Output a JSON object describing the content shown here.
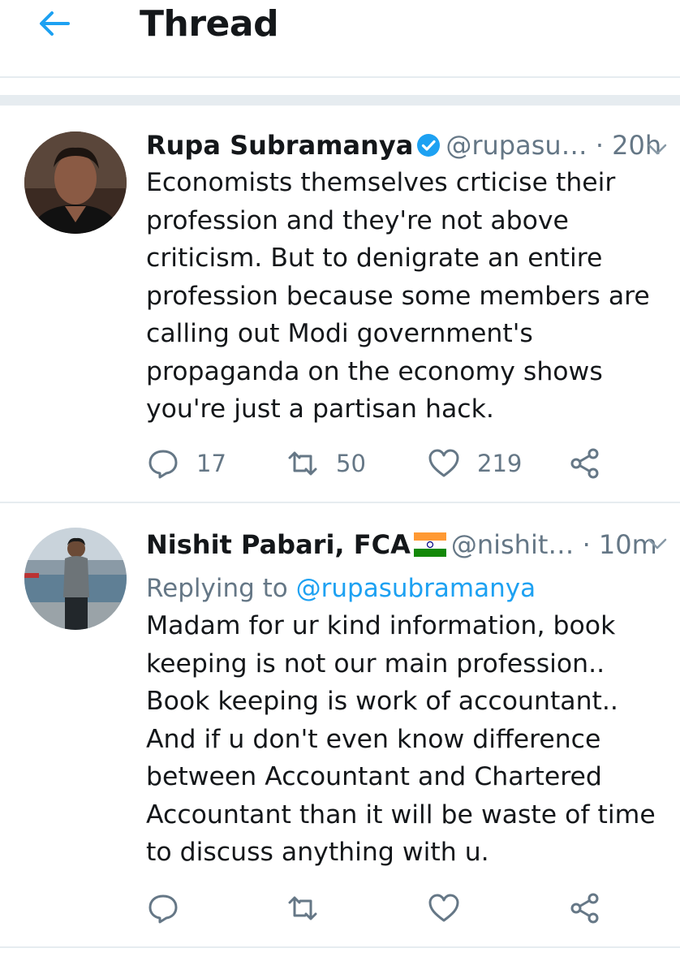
{
  "header": {
    "title": "Thread",
    "back_icon": "arrow-left-icon"
  },
  "tweets": [
    {
      "name": "Rupa Subramanya",
      "verified": true,
      "handle": "@rupasu…",
      "separator": "·",
      "time": "20h",
      "lines": [
        "Economists themselves crticise their",
        "profession and they're not above",
        "criticism. But to denigrate an entire",
        "profession because some members are",
        "calling out Modi government's",
        "propaganda on the economy shows",
        "you're just a partisan hack."
      ],
      "replies": "17",
      "retweets": "50",
      "likes": "219"
    },
    {
      "name": "Nishit Pabari, FCA",
      "flag": "india-flag-icon",
      "handle": "@nishit…",
      "separator": "·",
      "time": "10m",
      "replying_label": "Replying to",
      "replying_to": "@rupasubramanya",
      "lines": [
        "Madam for ur kind information, book",
        "keeping is not our main profession..",
        "Book keeping is work of accountant..",
        "And if u don't even know difference",
        "between Accountant and Chartered",
        "Accountant than it will be waste of time",
        "to discuss anything with u."
      ]
    }
  ],
  "colors": {
    "accent": "#1da1f2",
    "muted": "#657786",
    "divider": "#e6ecf0",
    "text": "#14171a"
  }
}
